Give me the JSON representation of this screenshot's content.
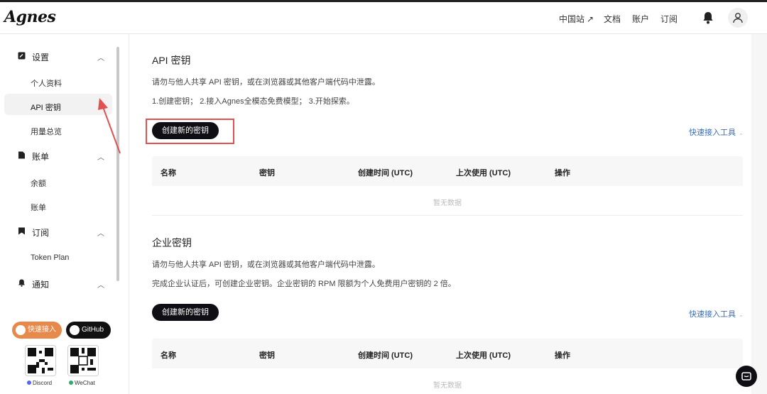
{
  "app": {
    "logo": "Agnes"
  },
  "header": {
    "nav": [
      "中国站",
      "文档",
      "账户",
      "订阅"
    ],
    "ext_icon": "↗"
  },
  "sidebar": {
    "settings": {
      "label": "设置",
      "items": [
        "个人资料",
        "API 密钥",
        "用量总览"
      ],
      "active": "API 密钥"
    },
    "billing": {
      "label": "账单",
      "items": [
        "余额",
        "账单"
      ]
    },
    "subscription": {
      "label": "订阅",
      "items": [
        "Token Plan"
      ]
    },
    "notifications": {
      "label": "通知"
    },
    "quick_button": "快速接入",
    "github_button": "GitHub",
    "discord_label": "Discord",
    "wechat_label": "WeChat"
  },
  "api_keys": {
    "title": "API 密钥",
    "warning": "请勿与他人共享 API 密钥，或在浏览器或其他客户端代码中泄露。",
    "steps": "1.创建密钥； 2.接入Agnes全模态免费模型； 3.开始探索。",
    "create_button": "创建新的密钥",
    "quick_tools": "快速接入工具",
    "columns": [
      "名称",
      "密钥",
      "创建时间 (UTC)",
      "上次使用 (UTC)",
      "操作"
    ],
    "empty": "暂无数据"
  },
  "enterprise_keys": {
    "title": "企业密钥",
    "warning": "请勿与他人共享 API 密钥，或在浏览器或其他客户端代码中泄露。",
    "note": "完成企业认证后，可创建企业密钥。企业密钥的 RPM 限额为个人免费用户密钥的 2 倍。",
    "create_button": "创建新的密钥",
    "quick_tools": "快速接入工具",
    "columns": [
      "名称",
      "密钥",
      "创建时间 (UTC)",
      "上次使用 (UTC)",
      "操作"
    ],
    "empty": "暂无数据"
  },
  "colors": {
    "accent": "#0e0e14",
    "quick": "#e8894c",
    "link": "#3a6db5",
    "annotation": "#e05252"
  }
}
